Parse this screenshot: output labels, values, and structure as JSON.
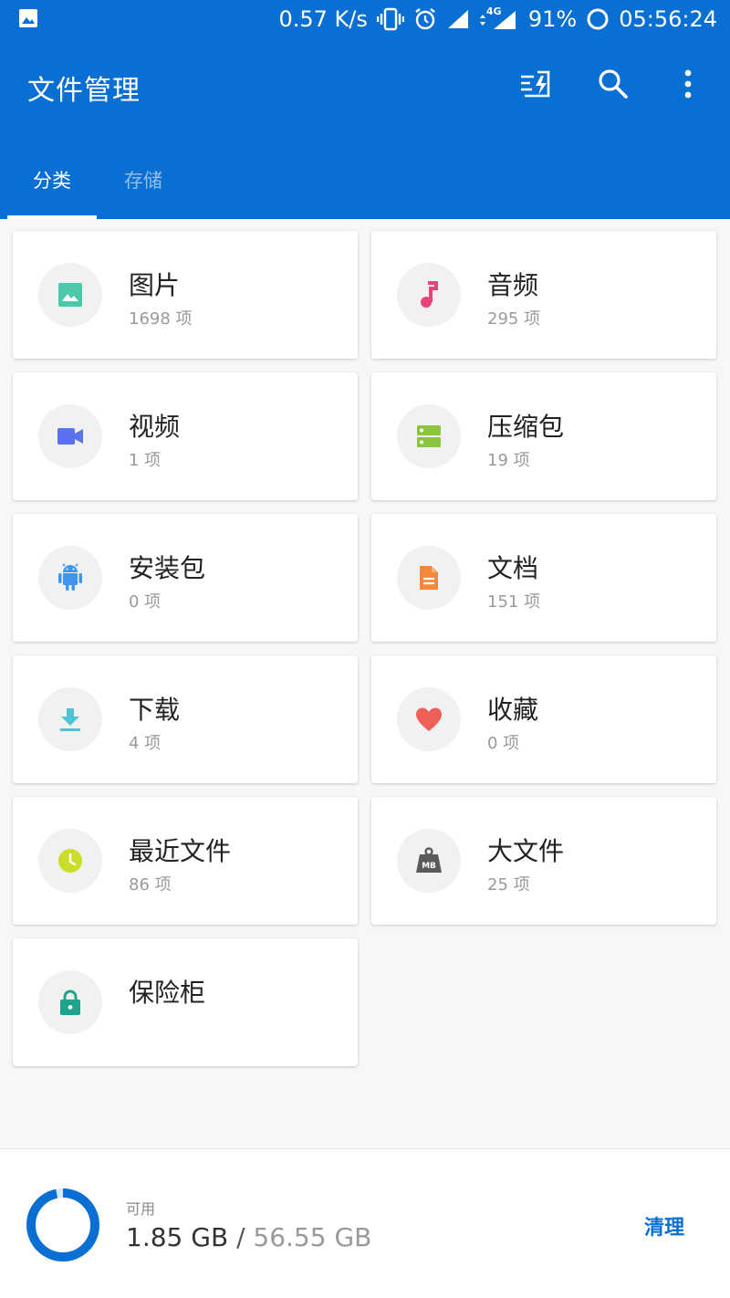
{
  "status_bar": {
    "speed": "0.57 K/s",
    "network": "4G",
    "battery": "91%",
    "time": "05:56:24"
  },
  "app_bar": {
    "title": "文件管理"
  },
  "tabs": [
    {
      "label": "分类",
      "active": true
    },
    {
      "label": "存储",
      "active": false
    }
  ],
  "categories": [
    {
      "name": "图片",
      "count": "1698 项",
      "icon": "image-icon",
      "color": "#4bc8a9"
    },
    {
      "name": "音频",
      "count": "295 项",
      "icon": "music-note-icon",
      "color": "#e8427c"
    },
    {
      "name": "视频",
      "count": "1 项",
      "icon": "video-camera-icon",
      "color": "#5b72f0"
    },
    {
      "name": "压缩包",
      "count": "19 项",
      "icon": "archive-icon",
      "color": "#8bc53f"
    },
    {
      "name": "安装包",
      "count": "0 项",
      "icon": "android-icon",
      "color": "#3d95ef"
    },
    {
      "name": "文档",
      "count": "151 项",
      "icon": "document-icon",
      "color": "#f4883a"
    },
    {
      "name": "下载",
      "count": "4 项",
      "icon": "download-icon",
      "color": "#4cc4d6"
    },
    {
      "name": "收藏",
      "count": "0 项",
      "icon": "heart-icon",
      "color": "#ef5e57"
    },
    {
      "name": "最近文件",
      "count": "86 项",
      "icon": "clock-icon",
      "color": "#cbdc2a"
    },
    {
      "name": "大文件",
      "count": "25 项",
      "icon": "mb-weight-icon",
      "color": "#5a5a5a"
    },
    {
      "name": "保险柜",
      "count": "",
      "icon": "lock-icon",
      "color": "#1ea38d"
    }
  ],
  "storage": {
    "label": "可用",
    "available": "1.85 GB",
    "separator": "/",
    "total": "56.55 GB",
    "used_fraction": 0.967,
    "clean_label": "清理"
  },
  "colors": {
    "primary": "#0a6fd3"
  }
}
